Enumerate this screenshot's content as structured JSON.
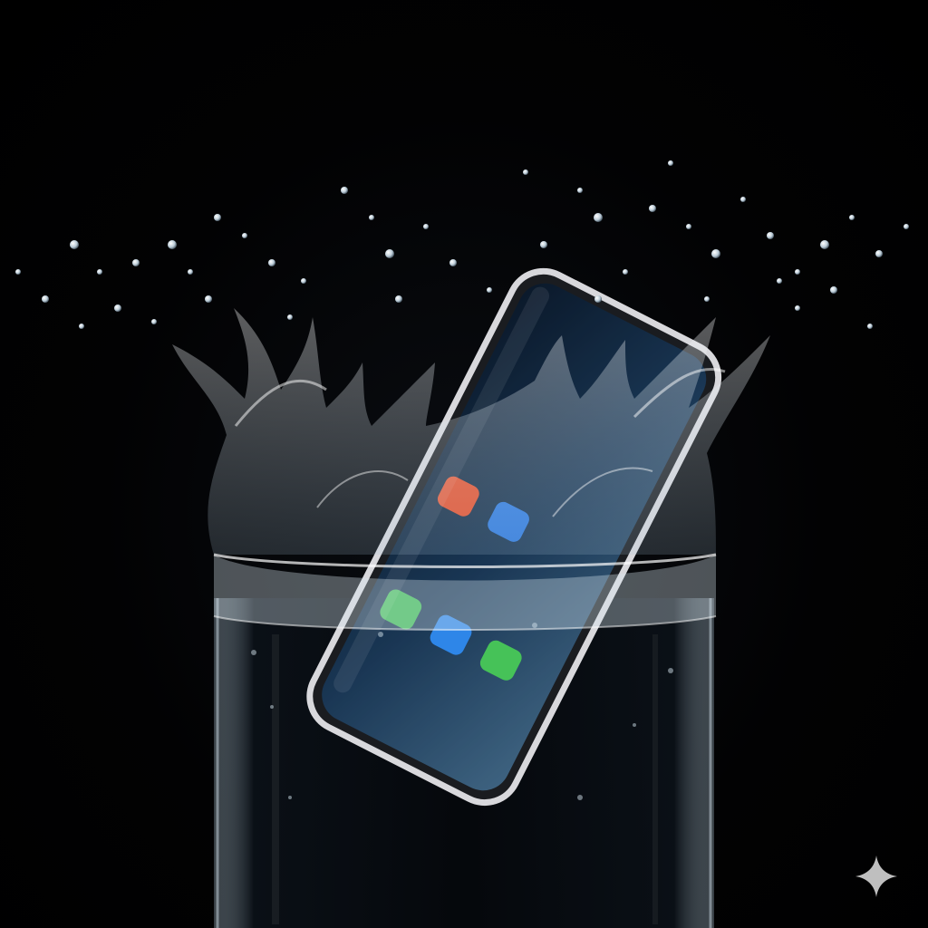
{
  "scene": {
    "subject": "smartphone",
    "container": "water-glass",
    "background_color": "#000000",
    "water_color": "#cfe3f0",
    "phone_frame_color": "#d8d8dc",
    "screen_color": "#1c3a5c"
  },
  "phone_screen": {
    "icons": [
      {
        "name": "orange-app-icon",
        "color": "#e8502a"
      },
      {
        "name": "blue-app-icon",
        "color": "#2f7be0"
      },
      {
        "name": "phone-app-icon",
        "color": "#3dbb52"
      },
      {
        "name": "mail-app-icon",
        "color": "#2e86e8"
      },
      {
        "name": "messages-app-icon",
        "color": "#46c258"
      }
    ]
  },
  "watermark": {
    "icon": "sparkle-icon",
    "color": "#bfbfbf"
  }
}
